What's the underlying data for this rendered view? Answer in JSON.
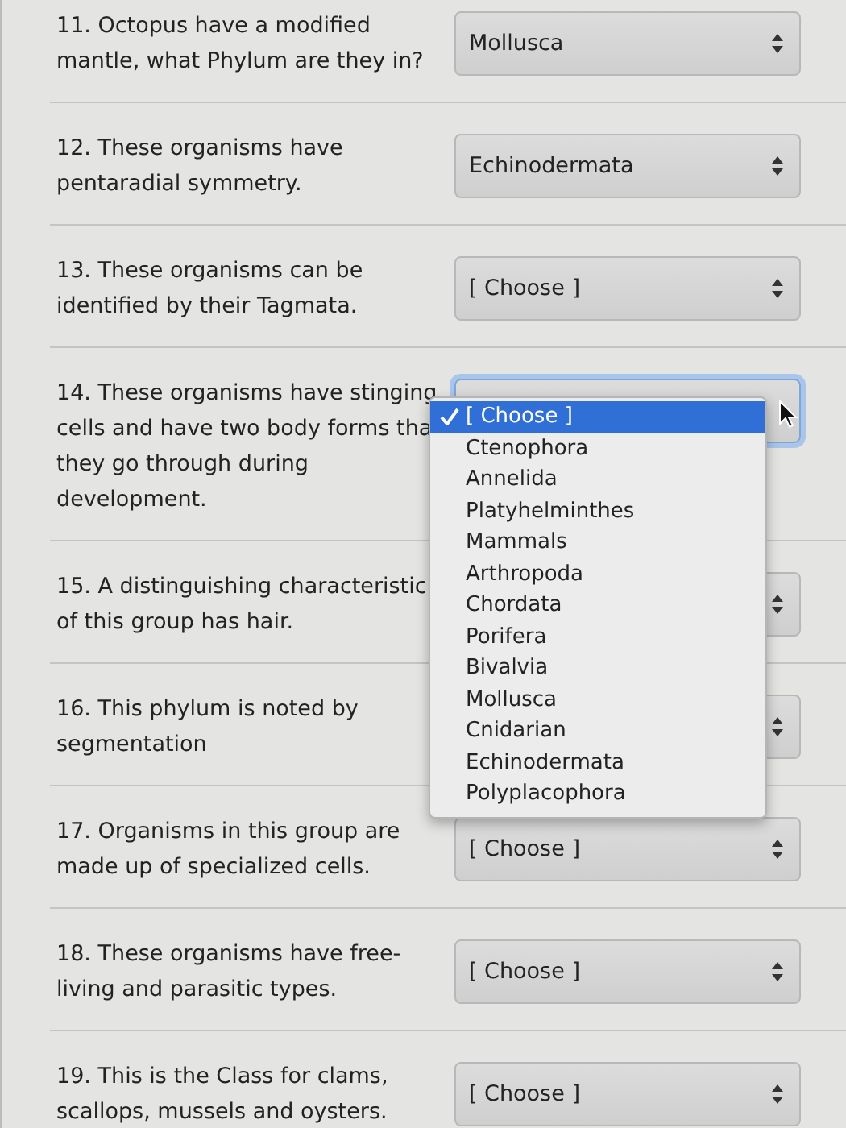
{
  "questions": [
    {
      "text": "11. Octopus have a modified\nmantle, what Phylum are they in?",
      "select": {
        "value": "Mollusca",
        "focused": false
      }
    },
    {
      "text": "12. These organisms have\npentaradial symmetry.",
      "select": {
        "value": "Echinodermata",
        "focused": false
      }
    },
    {
      "text": "13. These organisms can be\nidentified by their Tagmata.",
      "select": {
        "value": "[ Choose ]",
        "focused": false
      }
    },
    {
      "text": "14. These organisms have stinging\ncells and have two body forms tha\nthey go through during\ndevelopment.",
      "select": {
        "focused": true
      }
    },
    {
      "text": "15. A distinguishing characteristic\nof this group has hair.",
      "select": {
        "focused": false
      }
    },
    {
      "text": "16. This phylum is noted by\nsegmentation",
      "select": {
        "focused": false
      }
    },
    {
      "text": "17. Organisms in this group are\nmade up of specialized cells.",
      "select": {
        "value": "[ Choose ]",
        "focused": false
      }
    },
    {
      "text": "18. These organisms have free-\nliving and parasitic types.",
      "select": {
        "value": "[ Choose ]",
        "focused": false
      }
    },
    {
      "text": "19. This is the Class for clams,\nscallops, mussels and oysters.",
      "select": {
        "value": "[ Choose ]",
        "focused": false
      }
    }
  ],
  "open_menu": {
    "items": [
      {
        "label": "[ Choose ]",
        "selected": true
      },
      {
        "label": "Ctenophora",
        "selected": false
      },
      {
        "label": "Annelida",
        "selected": false
      },
      {
        "label": "Platyhelminthes",
        "selected": false
      },
      {
        "label": "Mammals",
        "selected": false
      },
      {
        "label": "Arthropoda",
        "selected": false
      },
      {
        "label": "Chordata",
        "selected": false
      },
      {
        "label": "Porifera",
        "selected": false
      },
      {
        "label": "Bivalvia",
        "selected": false
      },
      {
        "label": "Mollusca",
        "selected": false
      },
      {
        "label": "Cnidarian",
        "selected": false
      },
      {
        "label": "Echinodermata",
        "selected": false
      },
      {
        "label": "Polyplacophora",
        "selected": false
      }
    ]
  }
}
